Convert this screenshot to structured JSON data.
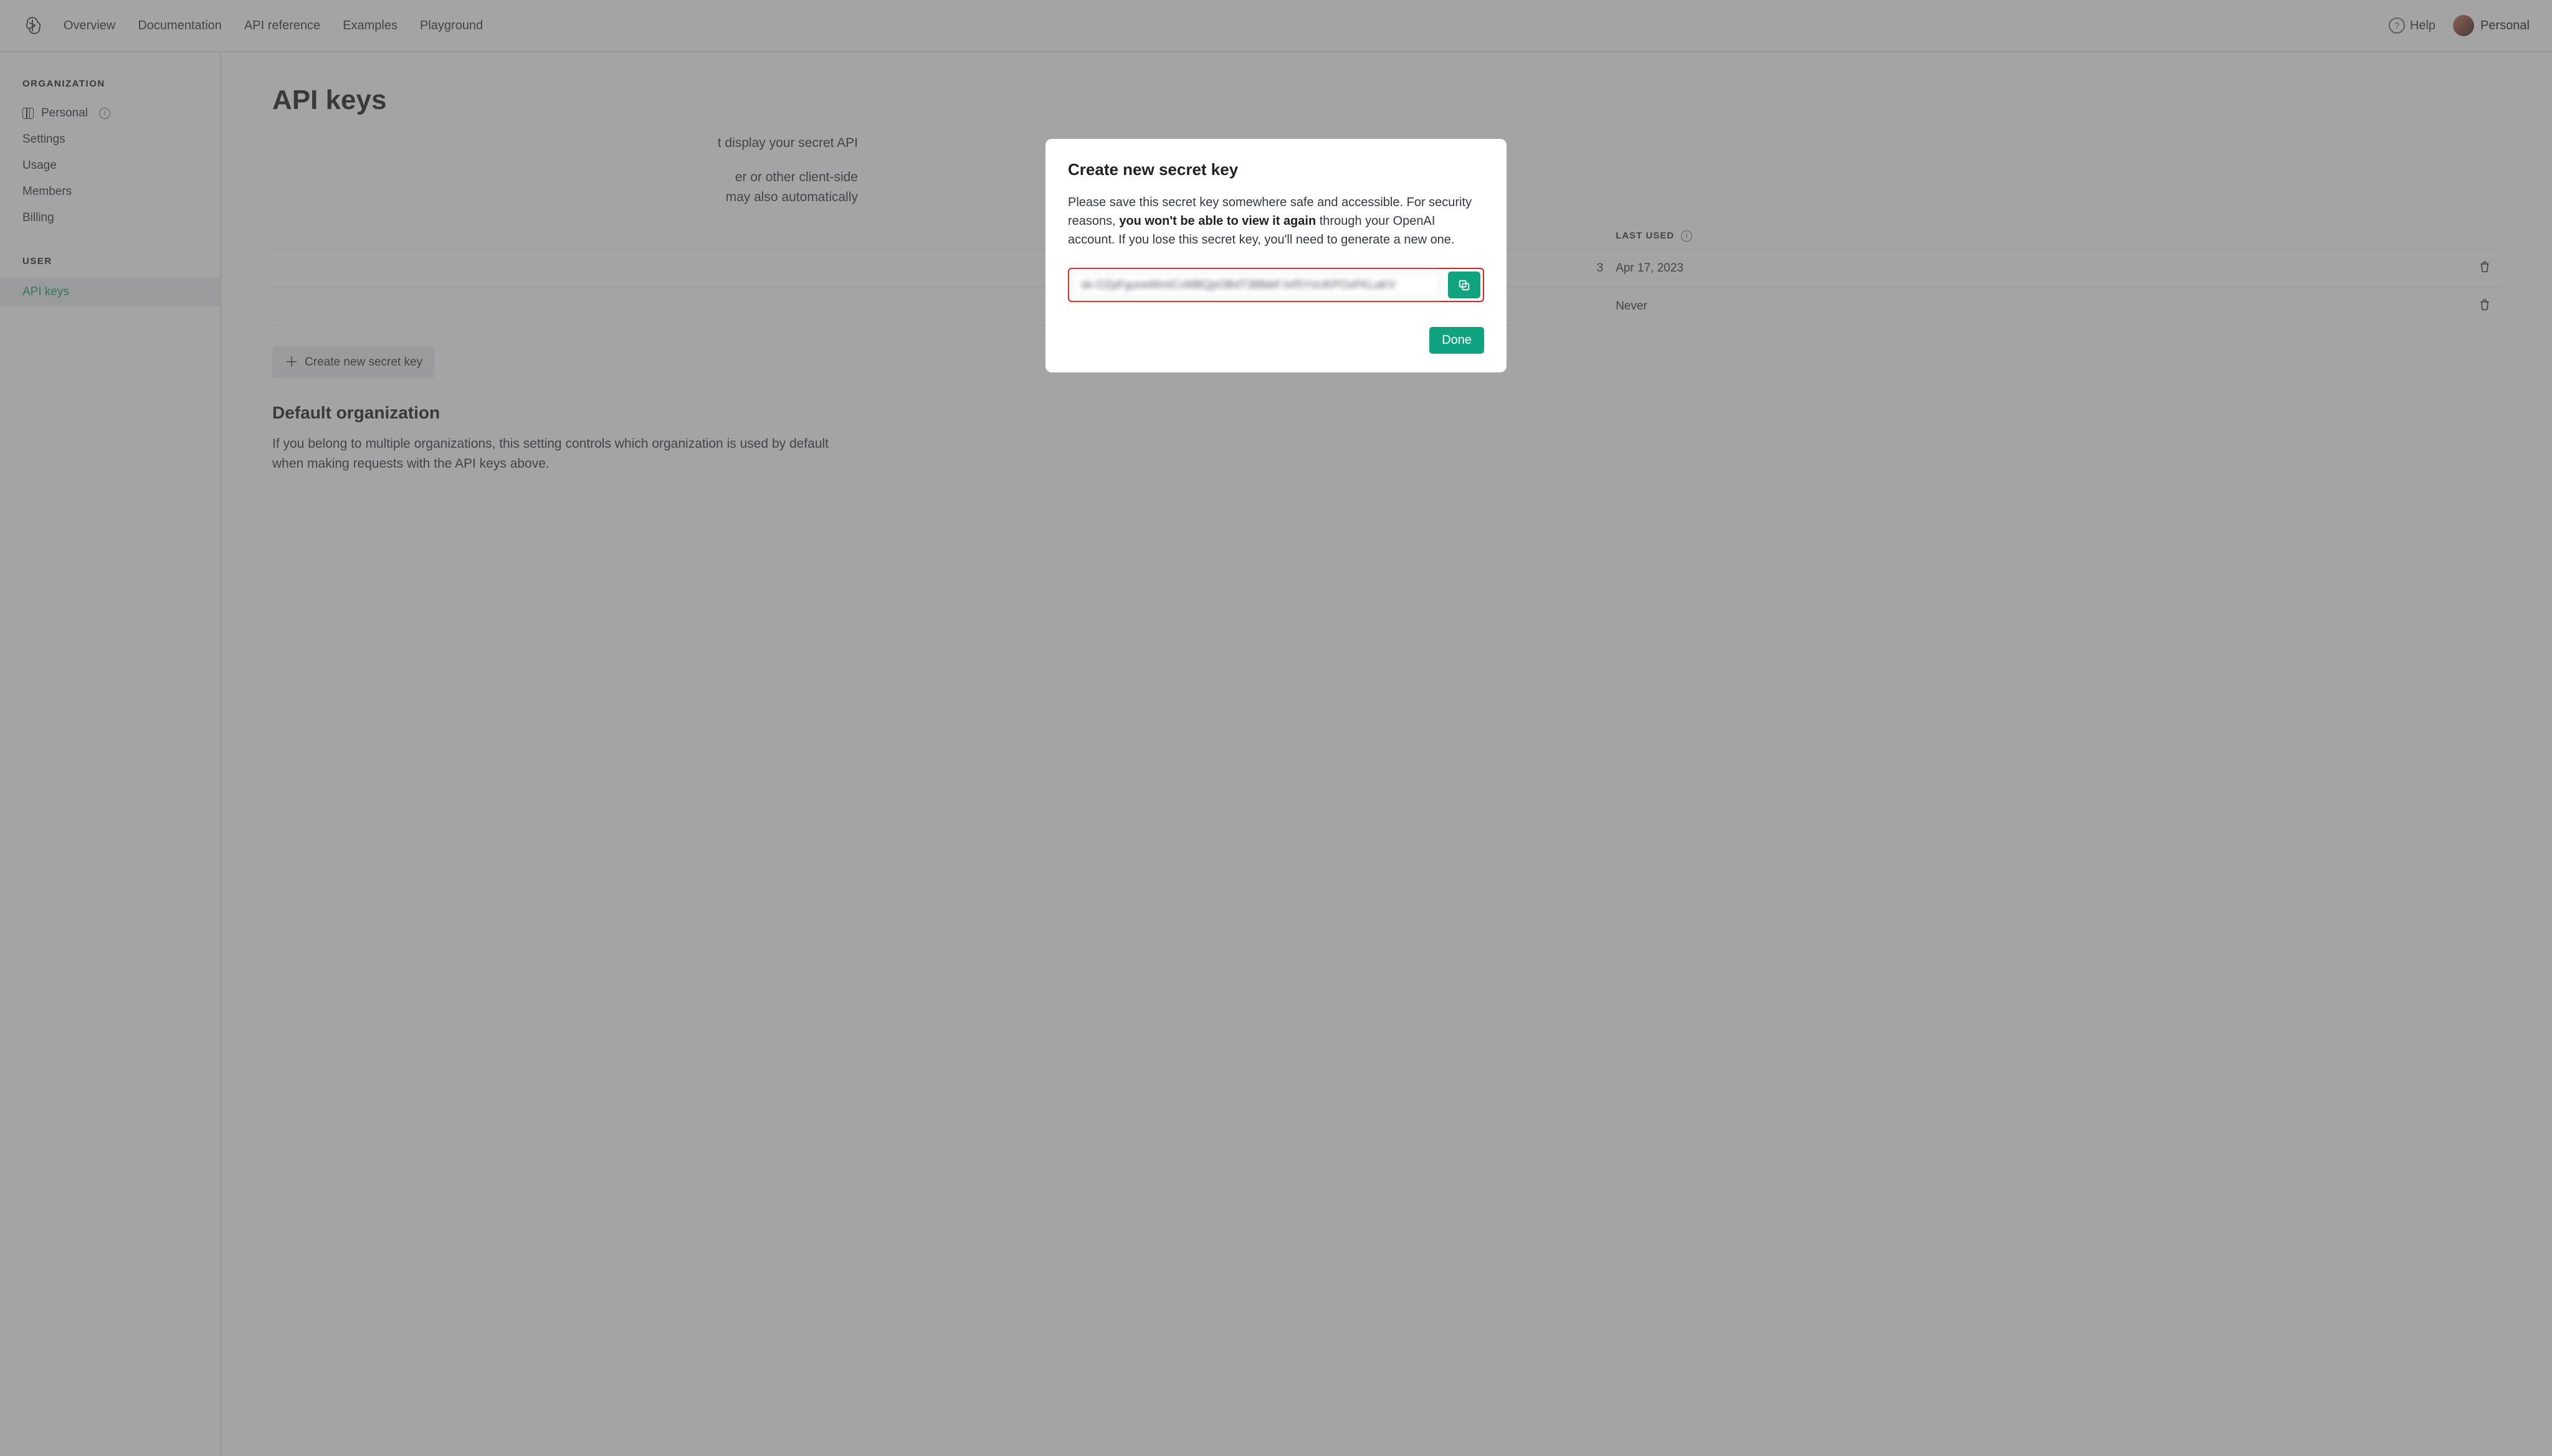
{
  "nav": {
    "links": [
      "Overview",
      "Documentation",
      "API reference",
      "Examples",
      "Playground"
    ],
    "help": "Help",
    "account": "Personal"
  },
  "sidebar": {
    "org_heading": "ORGANIZATION",
    "org_name": "Personal",
    "items_org": [
      "Settings",
      "Usage",
      "Members",
      "Billing"
    ],
    "user_heading": "USER",
    "items_user": [
      "API keys"
    ],
    "active": "API keys"
  },
  "page": {
    "title": "API keys",
    "intro_tail": "t display your secret API",
    "para2_tail_a": "er or other client-side",
    "para2_tail_b": "may also automatically",
    "create_btn": "Create new secret key",
    "default_org_title": "Default organization",
    "default_org_text": "If you belong to multiple organizations, this setting controls which organization is used by default when making requests with the API keys above."
  },
  "table": {
    "col_lastused": "LAST USED",
    "rows": [
      {
        "created_tail": "3",
        "last_used": "Apr 17, 2023"
      },
      {
        "created_tail": "",
        "last_used": "Never"
      }
    ]
  },
  "modal": {
    "title": "Create new secret key",
    "body_a": "Please save this secret key somewhere safe and accessible. For security reasons, ",
    "body_bold": "you won't be able to view it again",
    "body_b": " through your OpenAI account. If you lose this secret key, you'll need to generate a new one.",
    "key_value": "sk-OZpFgurwWmICvMBQpOBdT3BlbkFJvfSYsUKPOxFKLaKV",
    "done": "Done"
  }
}
